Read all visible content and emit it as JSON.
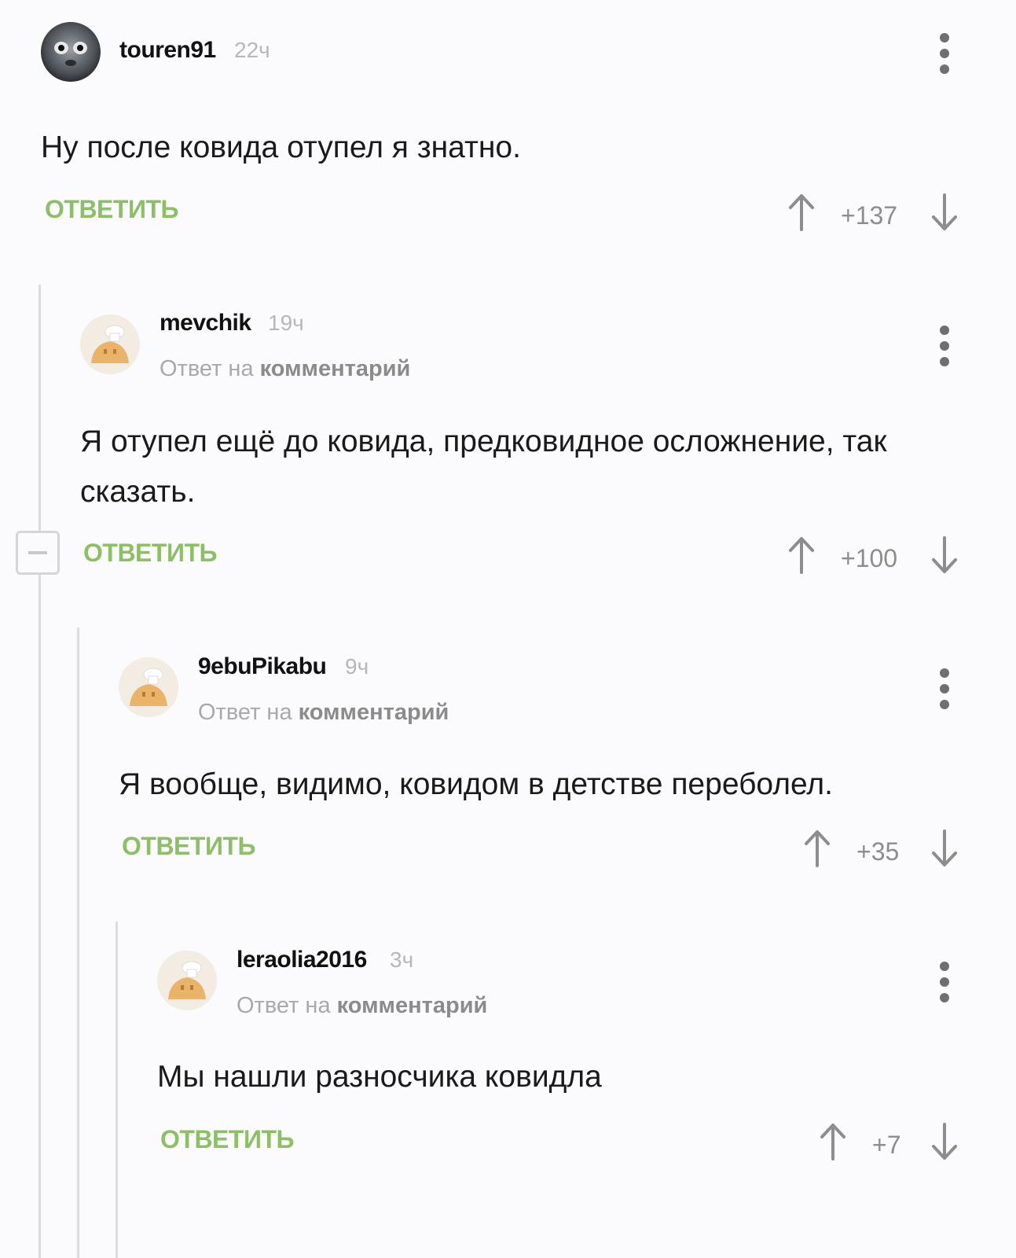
{
  "comments": [
    {
      "username": "touren91",
      "time": "22ч",
      "text": "Ну после ковида отупел я знатно.",
      "reply_label": "ОТВЕТИТЬ",
      "rating": "+137"
    },
    {
      "username": "mevchik",
      "time": "19ч",
      "reply_prefix": "Ответ на",
      "reply_link": "комментарий",
      "text": "Я отупел ещё до ковида, предковидное осложнение, так сказать.",
      "reply_label": "ОТВЕТИТЬ",
      "rating": "+100"
    },
    {
      "username": "9ebuPikabu",
      "time": "9ч",
      "reply_prefix": "Ответ на",
      "reply_link": "комментарий",
      "text": "Я вообще, видимо, ковидом в детстве переболел.",
      "reply_label": "ОТВЕТИТЬ",
      "rating": "+35"
    },
    {
      "username": "leraolia2016",
      "time": "3ч",
      "reply_prefix": "Ответ на",
      "reply_link": "комментарий",
      "text": "Мы нашли разносчика ковидла",
      "reply_label": "ОТВЕТИТЬ",
      "rating": "+7"
    }
  ],
  "colors": {
    "reply_green": "#8cbf66",
    "thread_line": "#dcdcdc",
    "background": "#fbfbfd"
  },
  "icons": [
    "more-vertical-icon",
    "upvote-arrow-icon",
    "downvote-arrow-icon",
    "collapse-minus-icon",
    "default-avatar-icon"
  ]
}
